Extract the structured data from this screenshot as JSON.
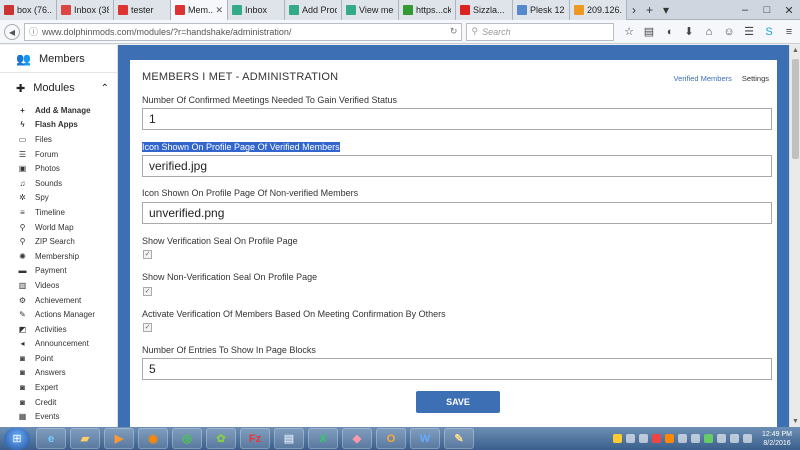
{
  "browser": {
    "tabs": [
      {
        "label": "box (76...",
        "color": "#c33"
      },
      {
        "label": "Inbox (38...",
        "color": "#d44"
      },
      {
        "label": "tester",
        "color": "#d33"
      },
      {
        "label": "Mem...",
        "color": "#d33",
        "active": true
      },
      {
        "label": "Inbox",
        "color": "#3a8"
      },
      {
        "label": "Add Prod...",
        "color": "#3a8"
      },
      {
        "label": "View mes...",
        "color": "#3a8"
      },
      {
        "label": "https...cker",
        "color": "#393"
      },
      {
        "label": "Sizzla...",
        "color": "#d22"
      },
      {
        "label": "Plesk 12.0...",
        "color": "#58c"
      },
      {
        "label": "209.126.1...",
        "color": "#e92"
      }
    ],
    "url": "www.dolphinmods.com/modules/?r=handshake/administration/",
    "search_placeholder": "Search"
  },
  "sidebar": {
    "members_label": "Members",
    "modules_label": "Modules",
    "items": [
      {
        "label": "Add & Manage",
        "icon": "+",
        "bold": true
      },
      {
        "label": "Flash Apps",
        "icon": "ϟ",
        "bold": true
      },
      {
        "label": "Files",
        "icon": "▭"
      },
      {
        "label": "Forum",
        "icon": "☰"
      },
      {
        "label": "Photos",
        "icon": "▣"
      },
      {
        "label": "Sounds",
        "icon": "♫"
      },
      {
        "label": "Spy",
        "icon": "✲"
      },
      {
        "label": "Timeline",
        "icon": "≡"
      },
      {
        "label": "World Map",
        "icon": "⚲"
      },
      {
        "label": "ZIP Search",
        "icon": "⚲"
      },
      {
        "label": "Membership",
        "icon": "✺"
      },
      {
        "label": "Payment",
        "icon": "▬"
      },
      {
        "label": "Videos",
        "icon": "▥"
      },
      {
        "label": "Achievement",
        "icon": "⚙"
      },
      {
        "label": "Actions Manager",
        "icon": "✎"
      },
      {
        "label": "Activities",
        "icon": "◩"
      },
      {
        "label": "Announcement",
        "icon": "◂"
      },
      {
        "label": "Point",
        "icon": "◙"
      },
      {
        "label": "Answers",
        "icon": "◙"
      },
      {
        "label": "Expert",
        "icon": "◙"
      },
      {
        "label": "Credit",
        "icon": "◙"
      },
      {
        "label": "Events",
        "icon": "▦"
      }
    ]
  },
  "panel": {
    "title": "MEMBERS I MET - ADMINISTRATION",
    "link_verified": "Verified Members",
    "link_settings": "Settings",
    "fields": [
      {
        "label": "Number Of Confirmed Meetings Needed To Gain Verified Status",
        "value": "1"
      },
      {
        "label": "Icon Shown On Profile Page Of Verified Members",
        "value": "verified.jpg"
      },
      {
        "label": "Icon Shown On Profile Page Of Non-verified Members",
        "value": "unverified.png"
      },
      {
        "label": "Number Of Entries To Show In Page Blocks",
        "value": "5"
      }
    ],
    "checks": [
      {
        "label": "Show Verification Seal On Profile Page",
        "checked": true
      },
      {
        "label": "Show Non-Verification Seal On Profile Page",
        "checked": true
      },
      {
        "label": "Activate Verification Of Members Based On Meeting Confirmation By Others",
        "checked": true
      }
    ],
    "save_label": "SAVE"
  },
  "taskbar": {
    "time": "12:49 PM",
    "date": "8/2/2016"
  },
  "colors": {
    "accent": "#3d6fb5",
    "highlight": "#3366cc"
  }
}
